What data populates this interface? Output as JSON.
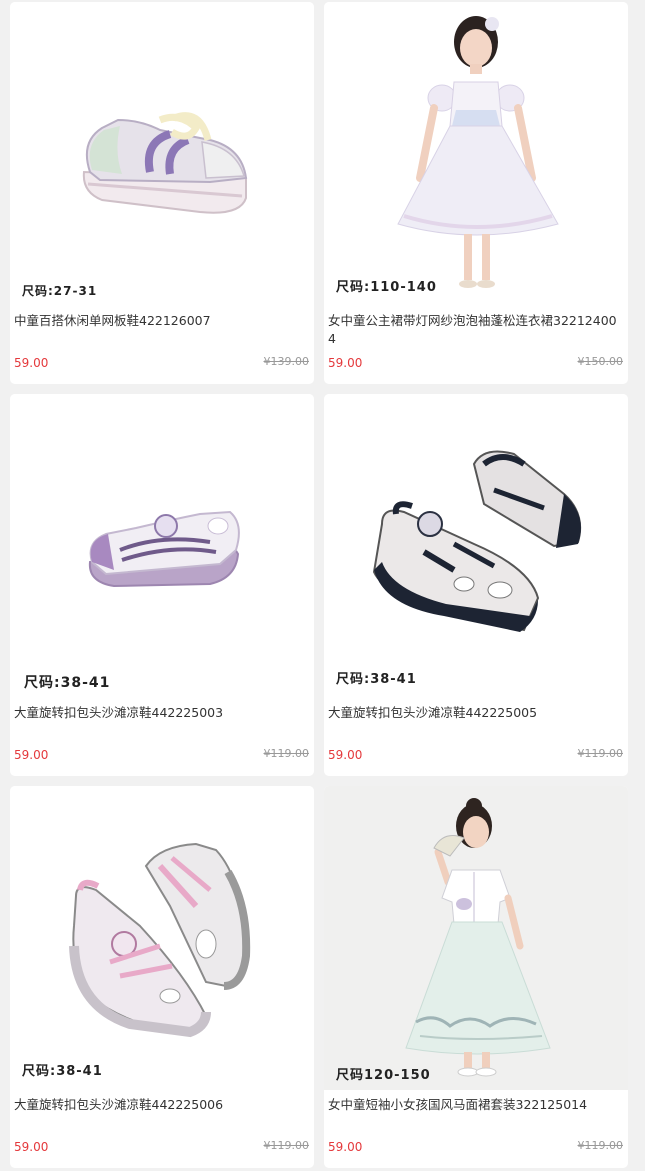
{
  "products": [
    {
      "size": "尺码:27-31",
      "title": "中童百搭休闲单网板鞋422126007",
      "price": "59.00",
      "original_price": "¥139.00",
      "image": "toddler-sneaker-lavender"
    },
    {
      "size": "尺码:110-140",
      "title": "女中童公主裙带灯网纱泡泡袖蓬松连衣裙322124004",
      "price": "59.00",
      "original_price": "¥150.00",
      "image": "girl-white-tulle-dress"
    },
    {
      "size": "尺码:38-41",
      "title": "大童旋转扣包头沙滩凉鞋442225003",
      "price": "59.00",
      "original_price": "¥119.00",
      "image": "sandal-white-purple"
    },
    {
      "size": "尺码:38-41",
      "title": "大童旋转扣包头沙滩凉鞋442225005",
      "price": "59.00",
      "original_price": "¥119.00",
      "image": "sandal-pair-navy-grey"
    },
    {
      "size": "尺码:38-41",
      "title": "大童旋转扣包头沙滩凉鞋442225006",
      "price": "59.00",
      "original_price": "¥119.00",
      "image": "sandal-pair-pink-grey"
    },
    {
      "size": "尺码120-150",
      "title": "女中童短袖小女孩国风马面裙套装322125014",
      "price": "59.00",
      "original_price": "¥119.00",
      "image": "girl-hanfu-skirt-set"
    }
  ],
  "colors": {
    "price": "#e4393c",
    "original_price": "#999999",
    "background": "#f1f1f1"
  }
}
